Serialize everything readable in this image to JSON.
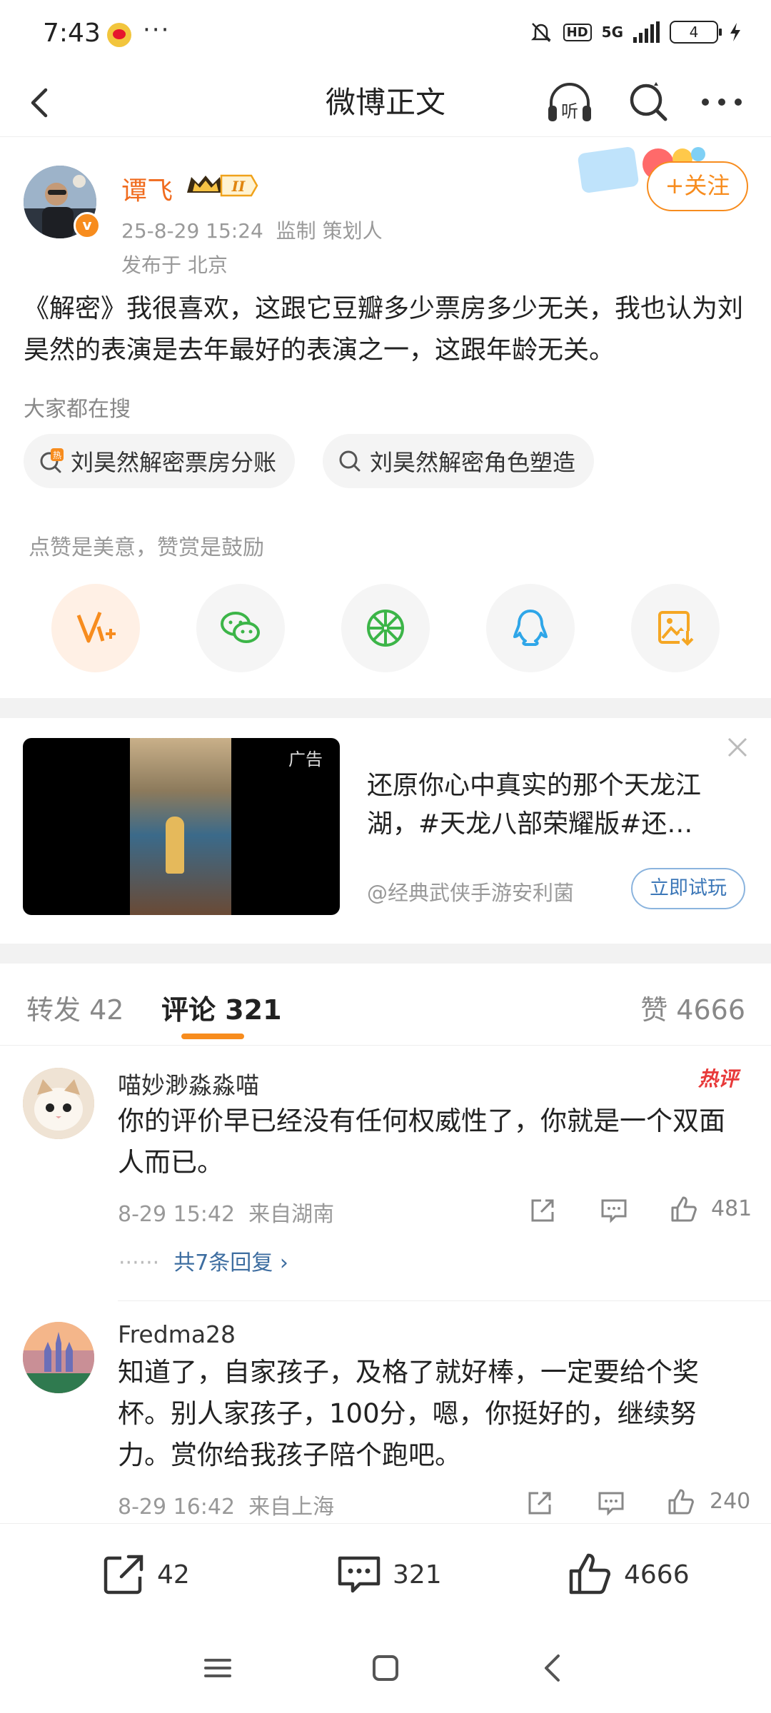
{
  "status_bar": {
    "time": "7:43",
    "more": "···",
    "network": "5G",
    "hd": "HD",
    "battery": "4"
  },
  "nav": {
    "title": "微博正文",
    "listen_label": "听"
  },
  "post": {
    "author": "谭飞",
    "level_badge": "II",
    "verified_badge": "v",
    "meta": "25-8-29 15:24  监制 策划人",
    "location": "发布于 北京",
    "follow_label": "+关注",
    "text": "《解密》我很喜欢，这跟它豆瓣多少票房多少无关，我也认为刘昊然的表演是去年最好的表演之一，这跟年龄无关。",
    "search_label": "大家都在搜",
    "search_chips": [
      {
        "text": "刘昊然解密票房分账",
        "hot_badge": "热"
      },
      {
        "text": "刘昊然解密角色塑造"
      }
    ],
    "reward_hint": "点赞是美意，赞赏是鼓励",
    "share_icons": [
      "reward-v-icon",
      "wechat-icon",
      "moments-icon",
      "qq-icon",
      "save-image-icon"
    ]
  },
  "ad": {
    "tag": "广告",
    "title": "还原你心中真实的那个天龙江湖，#天龙八部荣耀版#还…",
    "source": "@经典武侠手游安利菌",
    "button": "立即试玩"
  },
  "tabs": {
    "forward": "转发 42",
    "comment": "评论 321",
    "like": "赞 4666"
  },
  "comments": [
    {
      "name": "喵妙渺淼淼喵",
      "hot_tag": "热评",
      "text": "你的评价早已经没有任何权威性了，你就是一个双面人而已。",
      "meta": "8-29 15:42  来自湖南",
      "likes": "481",
      "reply_link": "共7条回复"
    },
    {
      "name": "Fredma28",
      "text": "知道了，自家孩子，及格了就好棒，一定要给个奖杯。别人家孩子，100分，嗯，你挺好的，继续努力。赏你给我孩子陪个跑吧。",
      "meta": "8-29 16:42  来自上海",
      "likes": "240"
    }
  ],
  "bottom_bar": {
    "forward_count": "42",
    "comment_count": "321",
    "like_count": "4666"
  },
  "colors": {
    "accent": "#f78c1e",
    "username": "#f06b1e",
    "link": "#3d6da0",
    "hot": "#e83a3a"
  }
}
